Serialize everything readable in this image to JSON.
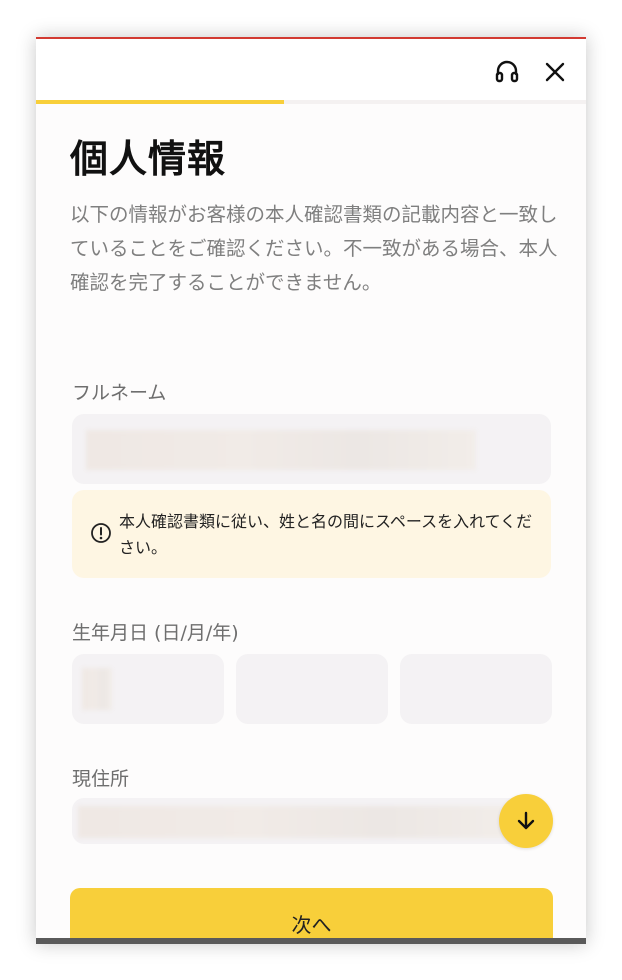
{
  "header": {
    "support_icon": "headset-icon",
    "close_icon": "close-icon",
    "progress": 0.45
  },
  "page": {
    "title": "個人情報",
    "intro": "以下の情報がお客様の本人確認書類の記載内容と一致していることをご確認ください。不一致がある場合、本人確認を完了することができません。"
  },
  "full_name": {
    "label": "フルネーム",
    "value": ""
  },
  "notice": {
    "icon": "info-icon",
    "text": "本人確認書類に従い、姓と名の間にスペースを入れてください。"
  },
  "birthdate": {
    "label": "生年月日 (日/月/年)",
    "day": "",
    "month": "",
    "year": ""
  },
  "address": {
    "label": "現住所",
    "value": "",
    "scroll_icon": "arrow-down-icon"
  },
  "actions": {
    "next_label": "次へ"
  },
  "colors": {
    "accent": "#f8cf3a",
    "notice_bg": "#fef6e3",
    "top_accent": "#d23a32"
  }
}
